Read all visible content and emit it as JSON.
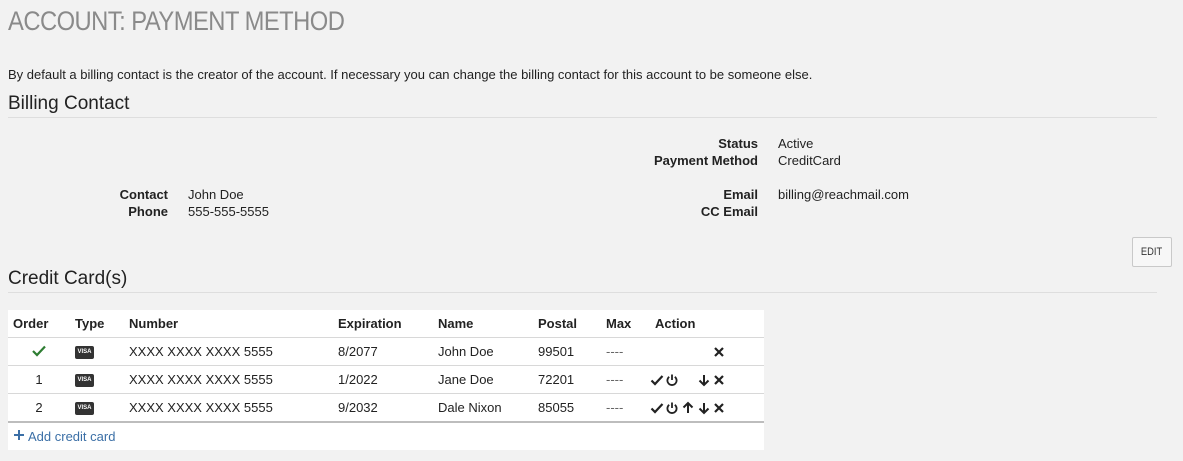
{
  "page": {
    "title": "ACCOUNT: PAYMENT METHOD",
    "intro": "By default a billing contact is the creator of the account. If necessary you can change the billing contact for this account to be someone else."
  },
  "billing": {
    "section_title": "Billing Contact",
    "status_label": "Status",
    "status_value": "Active",
    "payment_method_label": "Payment Method",
    "payment_method_value": "CreditCard",
    "contact_label": "Contact",
    "contact_value": "John Doe",
    "phone_label": "Phone",
    "phone_value": "555-555-5555",
    "email_label": "Email",
    "email_value": "billing@reachmail.com",
    "cc_email_label": "CC Email",
    "cc_email_value": "",
    "edit_label": "EDIT"
  },
  "credit_cards": {
    "section_title": "Credit Card(s)",
    "columns": [
      "Order",
      "Type",
      "Number",
      "Expiration",
      "Name",
      "Postal",
      "Max",
      "Action"
    ],
    "rows": [
      {
        "order": "",
        "order_icon": "checkmark-icon",
        "type": "VISA",
        "number": "XXXX XXXX XXXX 5555",
        "expiration": "8/2077",
        "name": "John Doe",
        "postal": "99501",
        "max": "----",
        "actions": [
          "delete-icon"
        ]
      },
      {
        "order": "1",
        "type": "VISA",
        "number": "XXXX XXXX XXXX 5555",
        "expiration": "1/2022",
        "name": "Jane Doe",
        "postal": "72201",
        "max": "----",
        "actions": [
          "set-default-check-icon",
          "power-icon",
          "move-down-icon",
          "delete-icon"
        ]
      },
      {
        "order": "2",
        "type": "VISA",
        "number": "XXXX XXXX XXXX 5555",
        "expiration": "9/2032",
        "name": "Dale Nixon",
        "postal": "85055",
        "max": "----",
        "actions": [
          "set-default-check-icon",
          "power-icon",
          "move-up-icon",
          "move-down-icon",
          "delete-icon"
        ]
      }
    ],
    "add_label": "Add credit card"
  },
  "colors": {
    "background": "#f2f2f2",
    "title_gray": "#8a8a8a",
    "link_blue": "#3b6fa6",
    "check_green": "#2e7d32"
  }
}
